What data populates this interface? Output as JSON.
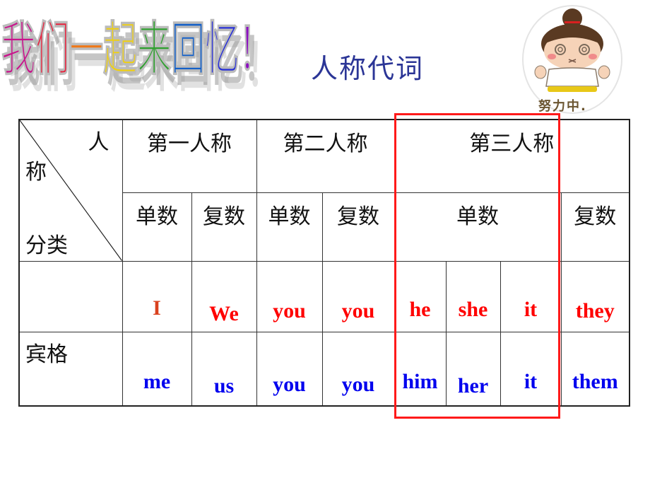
{
  "title": {
    "wordart_text": "我们一起来回忆！",
    "chars": [
      {
        "char": "我",
        "color": "#c8148c"
      },
      {
        "char": "们",
        "color": "#e8203c"
      },
      {
        "char": "一",
        "color": "#f07818"
      },
      {
        "char": "起",
        "color": "#f0d010"
      },
      {
        "char": "来",
        "color": "#30a030"
      },
      {
        "char": "回",
        "color": "#1460c8"
      },
      {
        "char": "忆",
        "color": "#2830d8"
      },
      {
        "char": "！",
        "color": "#8c10c0"
      }
    ]
  },
  "subtitle": "人称代词",
  "mascot": {
    "icon": "cartoon-girl-sticker",
    "caption": "努力中."
  },
  "table": {
    "corner": {
      "top_right": "人",
      "middle_left": "称",
      "bottom_left": "分类"
    },
    "persons": [
      "第一人称",
      "第二人称",
      "第三人称"
    ],
    "numbers": [
      "单数",
      "复数",
      "单数",
      "复数",
      "单数",
      "复数"
    ],
    "rows": [
      {
        "label": "",
        "color": "#ff0000",
        "cells": [
          "I",
          "We",
          "you",
          "you",
          "he",
          "she",
          "it",
          "they"
        ]
      },
      {
        "label": "宾格",
        "color": "#0000ee",
        "cells": [
          "me",
          "us",
          "you",
          "you",
          "him",
          "her",
          "it",
          "them"
        ]
      }
    ]
  },
  "highlight": {
    "color": "#ff1a1a",
    "covers": "第三人称 单数 (he/she/it, him/her/it)"
  }
}
